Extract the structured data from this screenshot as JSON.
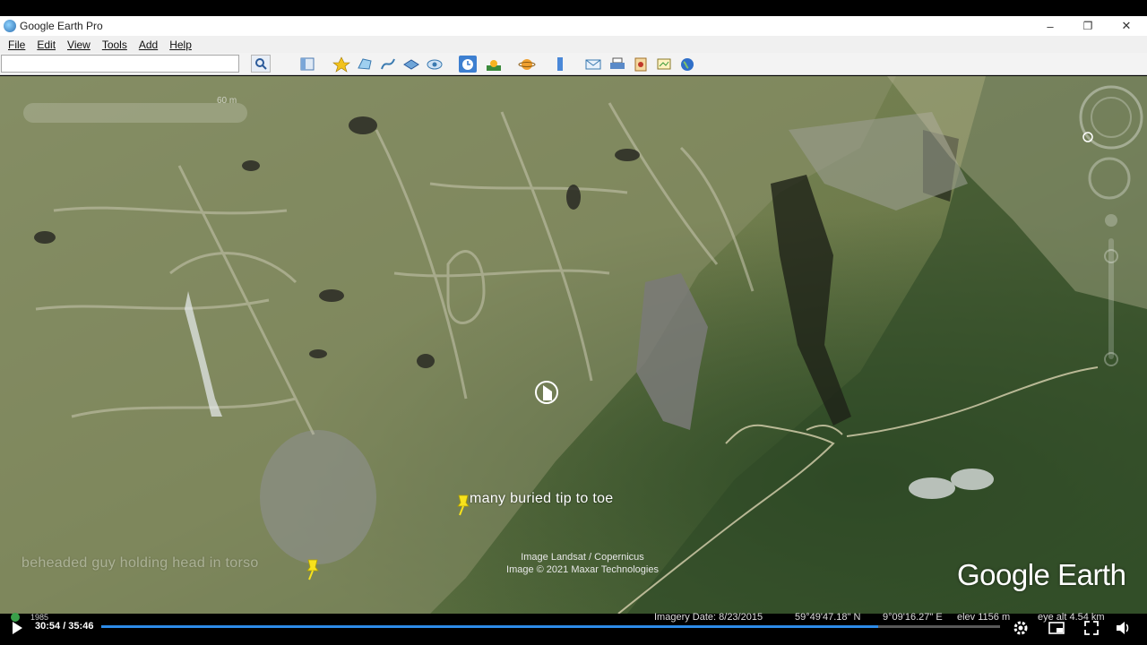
{
  "window": {
    "title": "Google Earth Pro",
    "minimize": "–",
    "restore": "❐",
    "close": "✕"
  },
  "menu": {
    "items": [
      {
        "label": "File"
      },
      {
        "label": "Edit"
      },
      {
        "label": "View"
      },
      {
        "label": "Tools"
      },
      {
        "label": "Add"
      },
      {
        "label": "Help"
      }
    ]
  },
  "toolbar": {
    "search_placeholder": "",
    "icons": [
      "search-icon",
      "sidebar-icon",
      "placemark-icon",
      "polygon-icon",
      "path-icon",
      "overlay-icon",
      "tour-icon",
      "historical-imagery-icon",
      "sun-icon",
      "planets-icon",
      "ruler-icon",
      "email-icon",
      "print-icon",
      "save-image-icon",
      "maps-icon",
      "earth-icon"
    ]
  },
  "map": {
    "scale_label": "60 m",
    "labels": [
      {
        "text": "many buried tip to toe"
      },
      {
        "text": "beheaded guy holding head in torso"
      }
    ],
    "attribution": [
      "Image Landsat / Copernicus",
      "Image © 2021 Maxar Technologies"
    ],
    "logo": "Google Earth"
  },
  "status": {
    "year": "1985",
    "imagery_date": "Imagery Date: 8/23/2015",
    "lat": "59°49'47.18\" N",
    "lon": "9°09'16.27\" E",
    "elev": "elev  1156 m",
    "eye_alt": "eye alt  4.54 km"
  },
  "player": {
    "time": "30:54 / 35:46",
    "progress_fraction": 0.864,
    "colors": {
      "progress": "#2d8be8"
    }
  }
}
